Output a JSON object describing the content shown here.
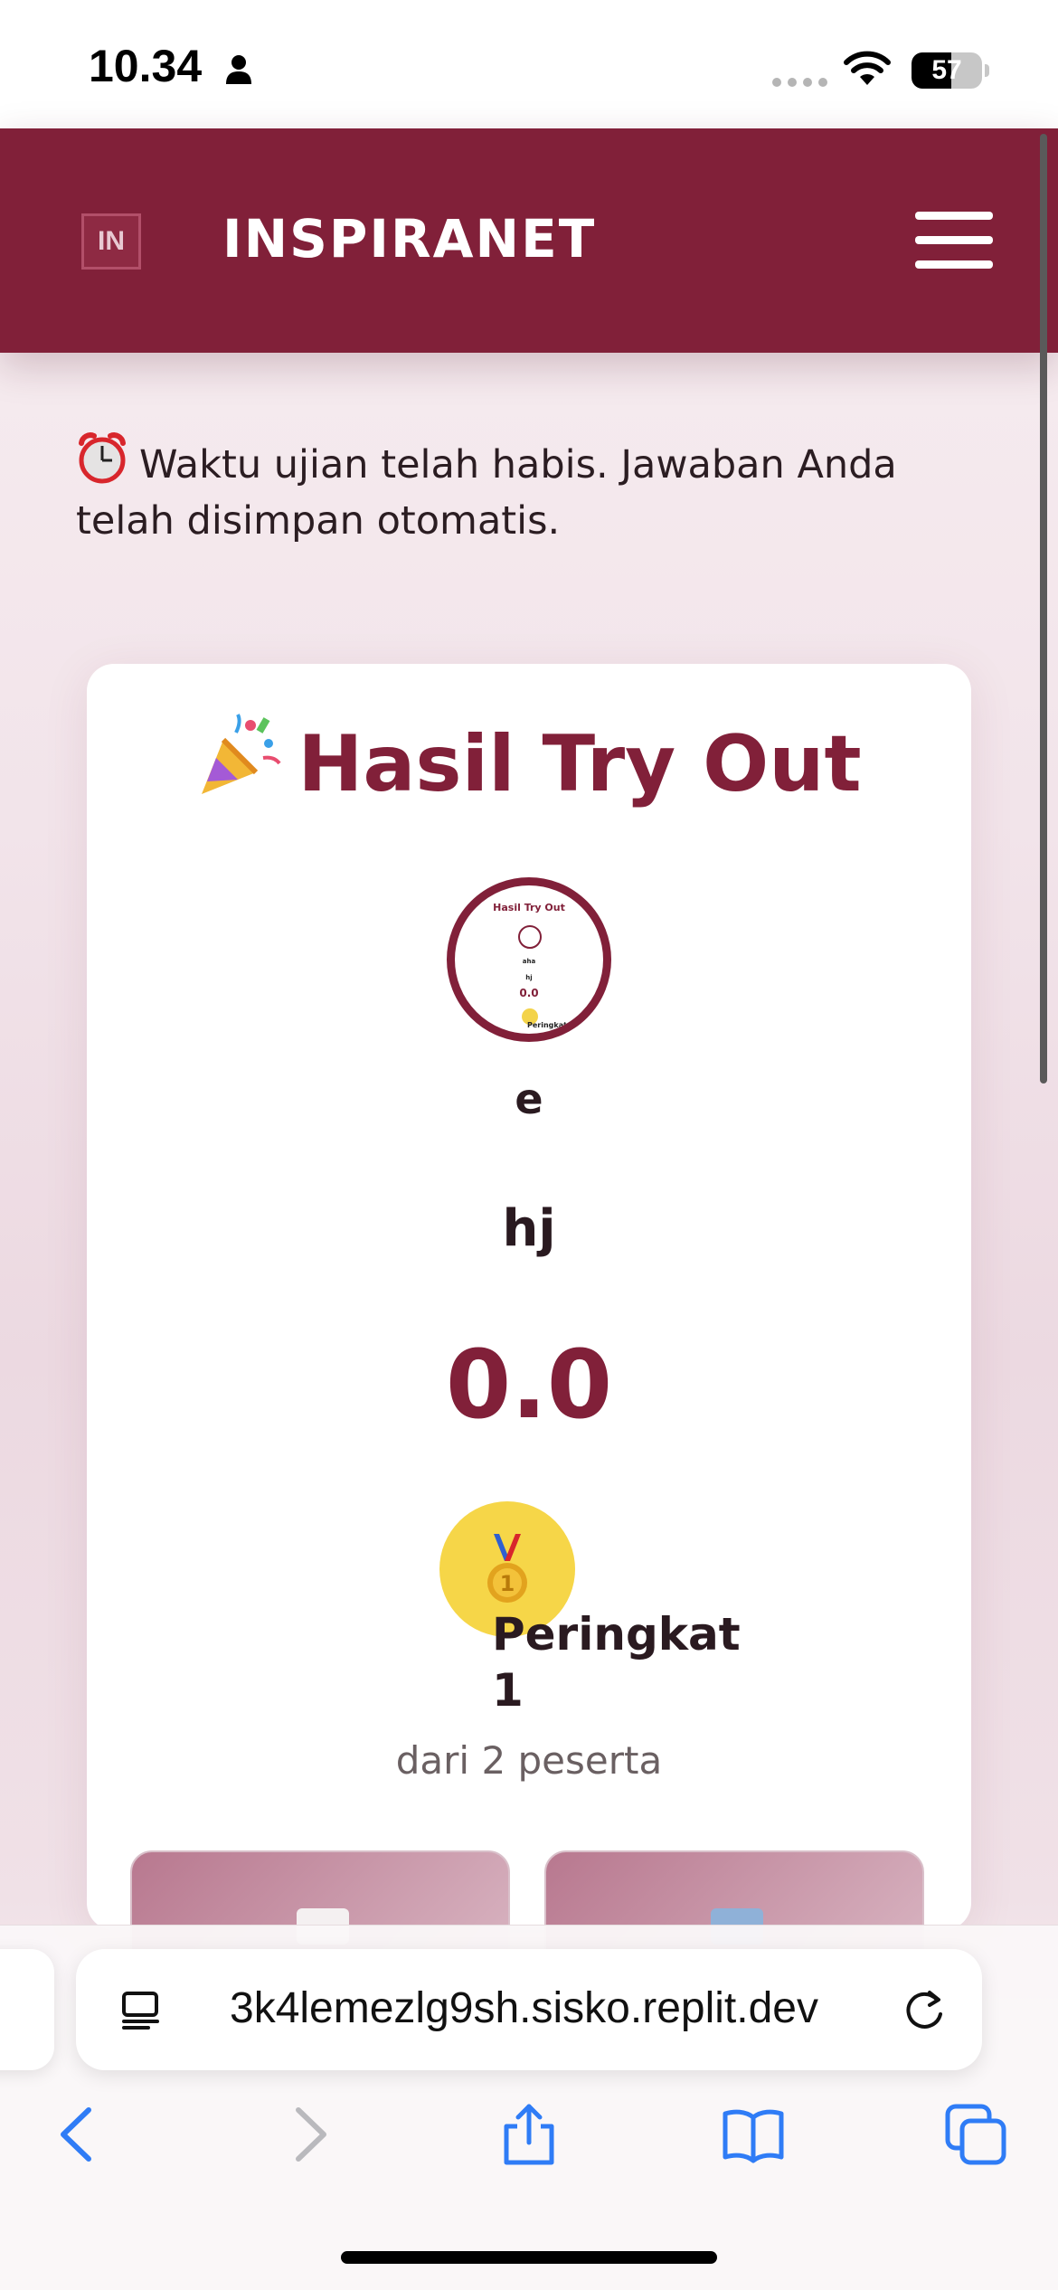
{
  "status_bar": {
    "time": "10.34",
    "battery_level": "57",
    "battery_fraction": 0.57
  },
  "header": {
    "logo_text": "IN",
    "brand_name": "INSPIRANET",
    "menu_icon": "hamburger-menu-icon"
  },
  "notice": {
    "icon": "alarm-clock-icon",
    "text": "Waktu ujian telah habis. Jawaban Anda telah disimpan otomatis."
  },
  "result": {
    "title_icon": "party-popper-icon",
    "title": "Hasil Try Out",
    "avatar_thumbnail": {
      "title": "Hasil Try Out",
      "line1": "aha",
      "line2": "hj",
      "score": "0.0",
      "rank": "Peringkat"
    },
    "name": "e",
    "school": "hj",
    "score": "0.0",
    "medal_icon": "first-place-medal-icon",
    "rank_label": "Peringkat",
    "rank_value": "1",
    "rank_total": "dari 2 peserta"
  },
  "browser": {
    "url": "3k4lemezlg9sh.sisko.replit.dev"
  },
  "colors": {
    "brand": "#812039",
    "medal_yellow": "#f6d648",
    "safari_blue": "#2f7cf6"
  }
}
